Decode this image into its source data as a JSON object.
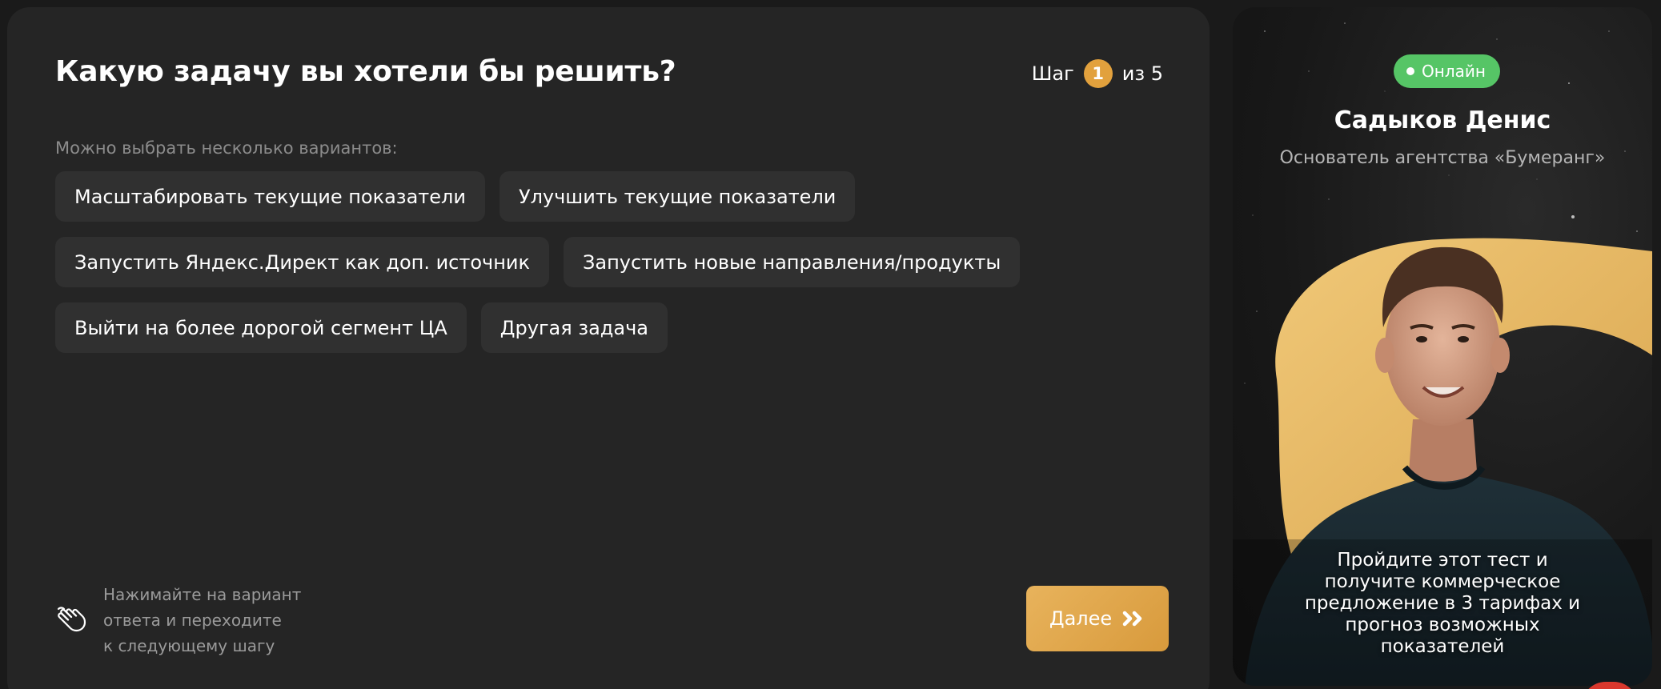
{
  "quiz": {
    "title": "Какую задачу вы хотели бы решить?",
    "step": {
      "prefix": "Шаг",
      "current": "1",
      "suffix": "из 5"
    },
    "hint": "Можно выбрать несколько вариантов:",
    "options": [
      "Масштабировать текущие показатели",
      "Улучшить текущие показатели",
      "Запустить Яндекс.Директ как доп. источник",
      "Запустить новые направления/продукты",
      "Выйти на более дорогой сегмент ЦА",
      "Другая задача"
    ],
    "footer_hint": [
      "Нажимайте на вариант",
      "ответа и переходите",
      "к следующему шагу"
    ],
    "footer_icon": "hand-pointer-icon",
    "next_label": "Далее",
    "next_icon": "double-chevron-right-icon"
  },
  "expert": {
    "status": "Онлайн",
    "name": "Садыков Денис",
    "role": "Основатель агентства «Бумеранг»",
    "caption": "Пройдите этот тест и получите коммерческое предложение в 3 тарифах и прогноз возможных показателей"
  },
  "colors": {
    "background": "#1a1a1a",
    "card": "#252525",
    "option": "#303030",
    "accent": "#e2a13d",
    "online": "#56c566"
  }
}
